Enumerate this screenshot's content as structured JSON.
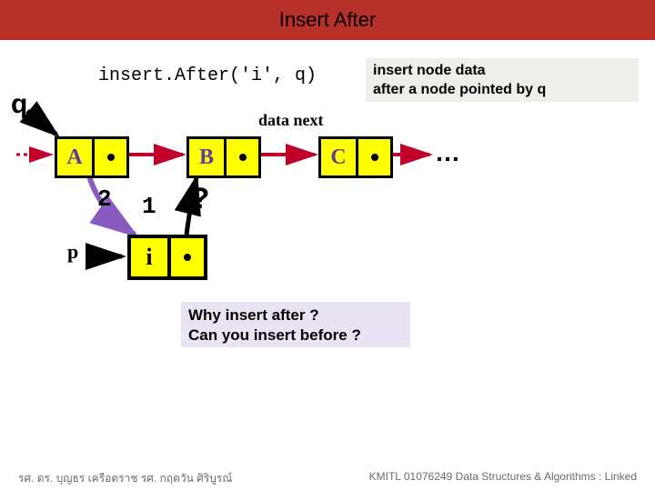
{
  "title": "Insert After",
  "code": "insert.After('i', q)",
  "description": {
    "line1": "insert node data",
    "line2": "after a node pointed by q"
  },
  "labels": {
    "q": "q",
    "p": "p",
    "dataNext": "data next",
    "ellipsisR": "…"
  },
  "nodes": {
    "a": "A",
    "b": "B",
    "c": "C",
    "i": "i"
  },
  "steps": {
    "s1": "1",
    "s2": "2",
    "qmark": "?"
  },
  "why": {
    "line1": "Why insert after ?",
    "line2": "Can you insert before ?"
  },
  "footer": {
    "left": "รศ. ดร. บุญธร   เครือตราช     รศ. กฤตวัน   ศิริบูรณ์",
    "right": "KMITL   01076249 Data Structures & Algorithms : Linked"
  },
  "colors": {
    "titleBar": "#b7302a",
    "nodeFill": "#ffff00",
    "whyFill": "#eae3f4"
  }
}
